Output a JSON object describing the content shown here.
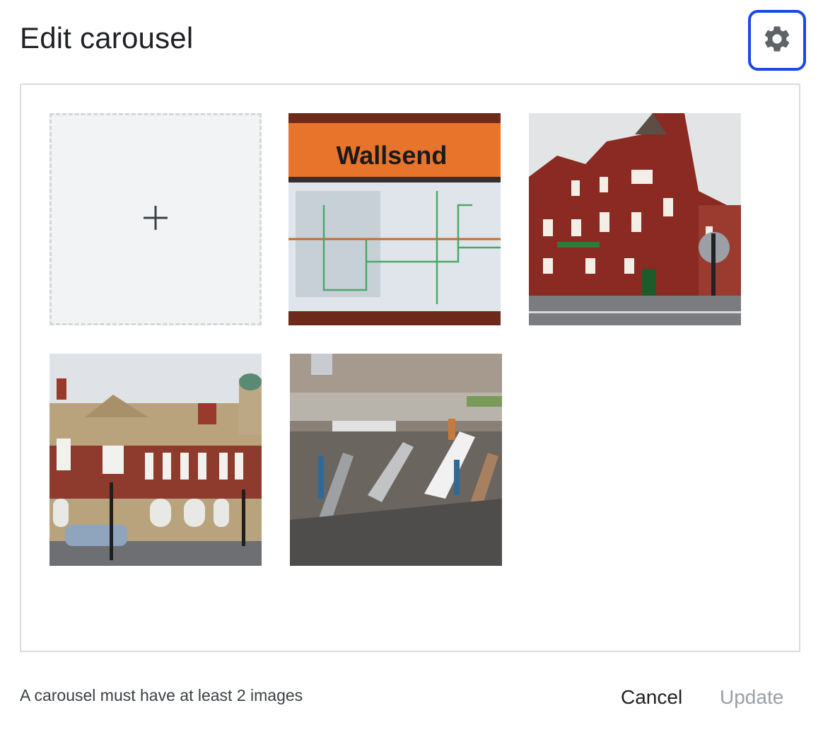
{
  "dialog": {
    "title": "Edit carousel",
    "settings_icon": "gear-icon",
    "add_icon": "plus-icon",
    "images": [
      {
        "label": "Wallsend",
        "alt": "Wallsend station sign and metro map"
      },
      {
        "alt": "Red brick corner building"
      },
      {
        "alt": "Stone civic building with dome"
      },
      {
        "alt": "Aerial view of shipyard with ships"
      }
    ],
    "note": "A carousel must have at least 2 images",
    "cancel_label": "Cancel",
    "update_label": "Update"
  },
  "colors": {
    "focus_ring": "#1a47e8",
    "panel_border": "#dadce0",
    "disabled_text": "#9aa0a6"
  }
}
